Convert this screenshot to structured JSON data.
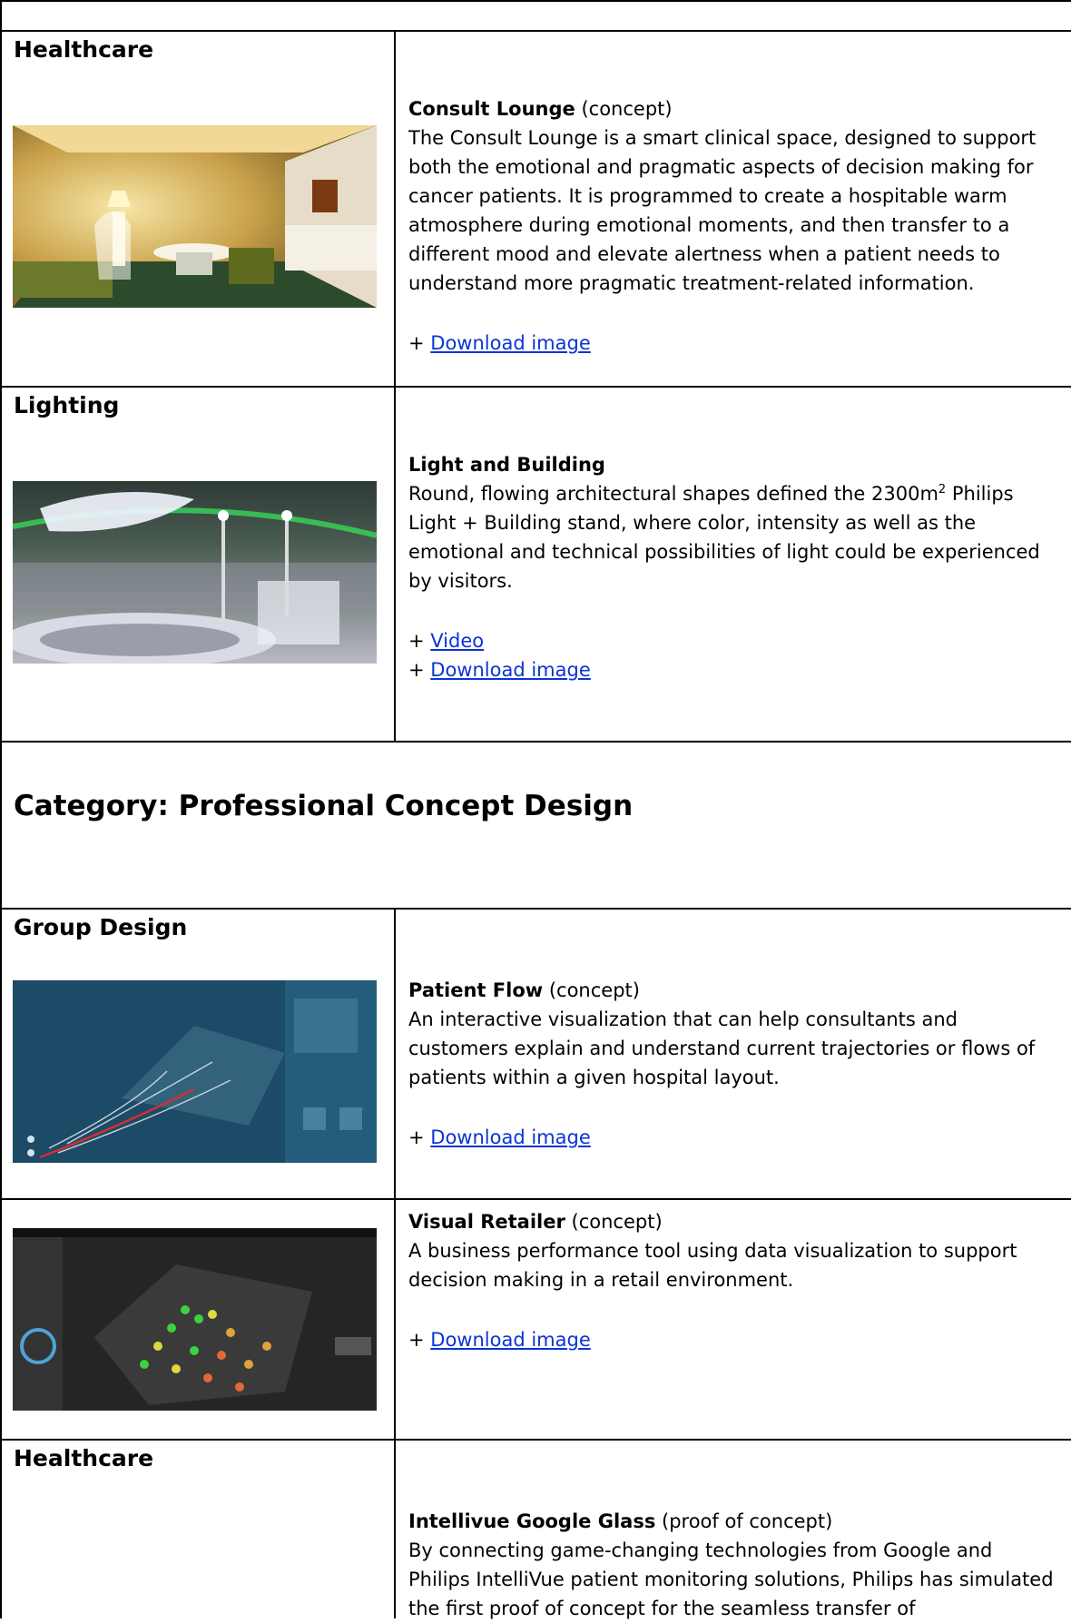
{
  "rows": [
    {
      "category": "Healthcare",
      "title": "Consult Lounge",
      "qualifier": " (concept)",
      "description": "The Consult Lounge is a smart clinical space, designed to support both the emotional and pragmatic aspects of decision making for cancer patients. It is programmed to create a hospitable warm atmosphere during emotional moments, and then transfer to a different mood and elevate alertness when a patient needs to understand more pragmatic treatment-related information.",
      "link_download": "Download image",
      "image": "consult-lounge-room"
    },
    {
      "category": "Lighting",
      "title": "Light and Building",
      "desc_before": "Round, flowing architectural shapes defined the 2300m",
      "desc_sup": "2",
      "desc_after": " Philips Light + Building stand, where color, intensity as well as the emotional and technical possibilities of light could be experienced by visitors.",
      "link_video": "Video",
      "link_download": "Download image",
      "image": "light-building-stand"
    }
  ],
  "section_heading": "Category: Professional Concept Design",
  "rows2": [
    {
      "category": "Group Design",
      "title": "Patient Flow",
      "qualifier": " (concept)",
      "description": "An interactive visualization that can help consultants and customers explain and understand current trajectories or flows of patients within a given hospital layout.",
      "link_download": "Download image",
      "image": "patient-flow-visualization"
    },
    {
      "category": "",
      "title": "Visual Retailer",
      "qualifier": " (concept)",
      "description": "A business performance tool using data visualization to support decision making in a retail environment.",
      "link_download": "Download image",
      "image": "visual-retailer-heatmap"
    },
    {
      "category": "Healthcare",
      "title": "Intellivue Google Glass",
      "qualifier": " (proof of concept)",
      "description": "By connecting game-changing technologies from Google and Philips IntelliVue patient monitoring solutions, Philips has simulated the first proof of concept for the seamless transfer of"
    }
  ],
  "link_prefix": "+ ",
  "colors": {
    "link": "#0a34d6",
    "border": "#000000"
  }
}
